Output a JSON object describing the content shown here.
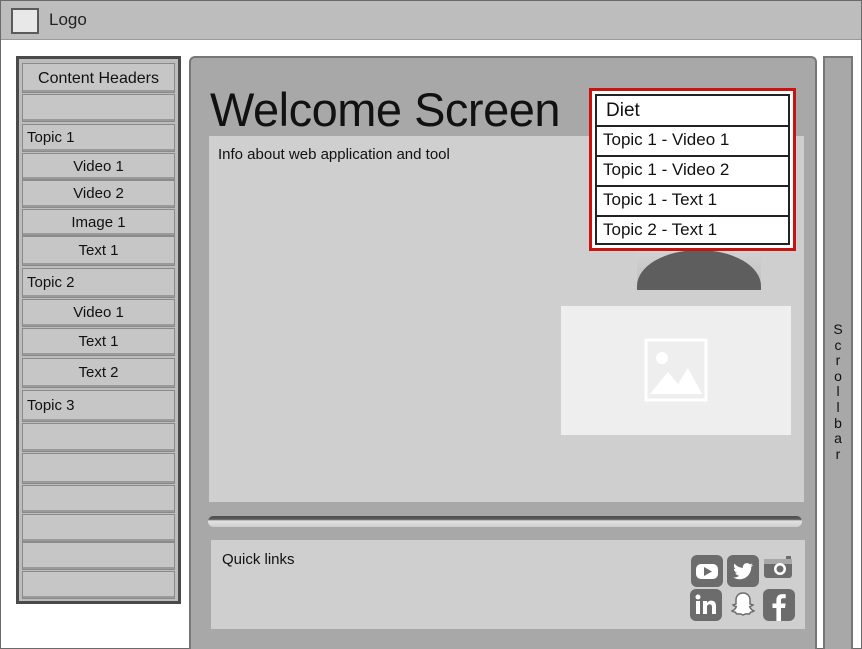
{
  "topbar": {
    "logo_label": "Logo"
  },
  "sidebar": {
    "header": "Content Headers",
    "rows": [
      {
        "label": "",
        "kind": "sub"
      },
      {
        "label": "Topic 1",
        "kind": "topic"
      },
      {
        "label": "Video 1",
        "kind": "sub"
      },
      {
        "label": "Video 2",
        "kind": "sub"
      },
      {
        "label": "Image 1",
        "kind": "sub"
      },
      {
        "label": "Text 1",
        "kind": "sub"
      },
      {
        "label": "Topic 2",
        "kind": "topic"
      },
      {
        "label": "Video 1",
        "kind": "sub"
      },
      {
        "label": "Text 1",
        "kind": "sub"
      },
      {
        "label": "Text 2",
        "kind": "sub"
      },
      {
        "label": "Topic 3",
        "kind": "topic"
      },
      {
        "label": "",
        "kind": "sub"
      },
      {
        "label": "",
        "kind": "sub"
      },
      {
        "label": "",
        "kind": "sub"
      },
      {
        "label": "",
        "kind": "sub"
      },
      {
        "label": "",
        "kind": "sub"
      },
      {
        "label": "",
        "kind": "sub"
      }
    ]
  },
  "main": {
    "title": "Welcome Screen",
    "info": "Info about web application and tool",
    "quick_links_label": "Quick links"
  },
  "search": {
    "value": "Diet",
    "results": [
      "Topic 1 - Video 1",
      "Topic 1 - Video 2",
      "Topic 1 - Text 1",
      "Topic 2 - Text 1"
    ]
  },
  "social": [
    "youtube-icon",
    "twitter-icon",
    "instagram-icon",
    "linkedin-icon",
    "snapchat-icon",
    "facebook-icon"
  ],
  "scrollbar": {
    "label": "Scrollbar"
  },
  "colors": {
    "highlight": "#cc1111",
    "panel": "#cfcfcf",
    "chrome": "#a8a8a8"
  }
}
